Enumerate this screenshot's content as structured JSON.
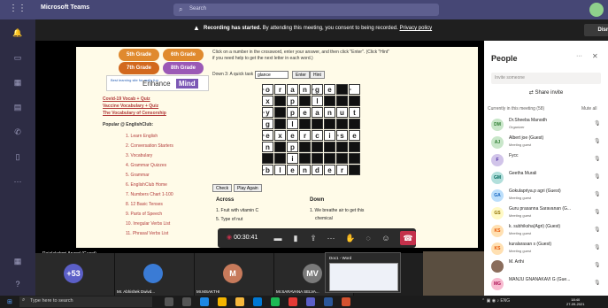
{
  "titlebar": {
    "app": "Microsoft Teams",
    "search_placeholder": "Search"
  },
  "banner": {
    "bold": "Recording has started.",
    "text": " By attending this meeting, you consent to being recorded. ",
    "link": "Privacy policy",
    "dismiss": "Dismiss"
  },
  "shared": {
    "grades": [
      "5th Grade",
      "6th Grade",
      "7th Grade",
      "8th Grade"
    ],
    "grade_colors": [
      "#e08a2e",
      "#e08a2e",
      "#d2691e",
      "#9b59b6"
    ],
    "mind": {
      "small": "Best learning site for really fun",
      "mid": "Enhance",
      "badge": "Mind"
    },
    "links_bold": [
      "Covid-19 Vocab + Quiz",
      "Vaccine Vocabulary + Quiz",
      "The Vocabulary of Censorship"
    ],
    "popular": "Popular @ EnglishClub:",
    "links": [
      "1. Learn English",
      "2. Conversation Starters",
      "3. Vocabulary",
      "4. Grammar Quizzes",
      "5. Grammar",
      "6. EnglishClub Home",
      "7. Numbers Chart 1-100",
      "8. 12 Basic Tenses",
      "9. Parts of Speech",
      "10. Irregular Verbs List",
      "11. Phrasal Verbs List"
    ],
    "instructions": "Click on a number in the crossword, enter your answer, and then click \"Enter\". (Click \"Hint\" if you need help to get the next letter in each word.)",
    "down_label": "Down 3: A quick task",
    "answer": "glance",
    "enter": "Enter",
    "hint": "Hint",
    "check": "Check",
    "play_again": "Play Again",
    "across_h": "Across",
    "down_h": "Down",
    "across_clues": [
      "1. Fruit with vitamin C",
      "5. Type of nut"
    ],
    "down_clues": [
      "1. We breathe air to get this",
      "chemical"
    ],
    "crossword": [
      [
        "",
        "1o",
        "r",
        "a",
        "n",
        "2g",
        "e",
        "",
        "3"
      ],
      [
        "",
        "x",
        "",
        "p",
        "",
        "l",
        "",
        "",
        ""
      ],
      [
        "",
        "4y",
        "",
        "p",
        "e",
        "a",
        "n",
        "u",
        "t"
      ],
      [
        "",
        "g",
        "",
        "l",
        "",
        "",
        "",
        "",
        ""
      ],
      [
        "",
        "5e",
        "x",
        "e",
        "r",
        "c",
        "i",
        "6s",
        "e"
      ],
      [
        "",
        "n",
        "",
        "p",
        "",
        "",
        "",
        "",
        ""
      ],
      [
        "",
        "",
        "",
        "i",
        "",
        "",
        "",
        "",
        ""
      ],
      [
        "",
        "7b",
        "l",
        "e",
        "n",
        "d",
        "e",
        "r",
        ""
      ]
    ]
  },
  "call": {
    "time": "00:30:41",
    "presenter": "Rajalakshmi Anand (Guest)",
    "word_tip": "Doc1 - Word"
  },
  "tiles": [
    {
      "label": "+53",
      "name": "",
      "color": "#5b5fc7"
    },
    {
      "label": "",
      "name": "Mr. Abhishek Dwivd...",
      "color": "#3a7bd5"
    },
    {
      "label": "M",
      "name": "Mr.MSAKTHI",
      "color": "#c77a5b"
    },
    {
      "label": "MV",
      "name": "Mr.SARAVANA SELVA...",
      "color": "#7a7a7a"
    }
  ],
  "people": {
    "title": "People",
    "invite_placeholder": "Invite someone",
    "share_invite": "Share invite",
    "currently": "Currently in this meeting (58)",
    "mute_all": "Mute all",
    "members": [
      {
        "initials": "DM",
        "name": "Dr.Sheeba Manodh",
        "role": "Organizer",
        "bg": "#c8e6c9",
        "fg": "#2e7d32"
      },
      {
        "initials": "AJ",
        "name": "Albert joe (Guest)",
        "role": "Meeting guest",
        "bg": "#c8e6c9",
        "fg": "#2e7d32"
      },
      {
        "initials": "F",
        "name": "Fycc",
        "role": "",
        "bg": "#d1c4e9",
        "fg": "#4527a0"
      },
      {
        "initials": "GM",
        "name": "Geetha Murali",
        "role": "",
        "bg": "#b2dfdb",
        "fg": "#00695c"
      },
      {
        "initials": "GA",
        "name": "Gokulapriya.p agri (Guest)",
        "role": "Meeting guest",
        "bg": "#bbdefb",
        "fg": "#1565c0"
      },
      {
        "initials": "GS",
        "name": "Guru prasanna Saravanan (G...",
        "role": "Meeting guest",
        "bg": "#fff9c4",
        "fg": "#8d6e00"
      },
      {
        "initials": "KS",
        "name": "k. subhiksha(Agri) (Guest)",
        "role": "Meeting guest",
        "bg": "#ffe0b2",
        "fg": "#e65100"
      },
      {
        "initials": "KS",
        "name": "kuralarasan s (Guest)",
        "role": "Meeting guest",
        "bg": "#ffe0b2",
        "fg": "#e65100"
      },
      {
        "initials": "",
        "name": "M. Arthi",
        "role": "",
        "bg": "#8a6d5c",
        "fg": "#fff"
      },
      {
        "initials": "MG",
        "name": "MANJU GNANAKAVI G (Gue...",
        "role": "",
        "bg": "#f8bbd0",
        "fg": "#ad1457"
      }
    ]
  },
  "taskbar": {
    "search": "Type here to search",
    "time": "18:40",
    "date": "27-09-2021",
    "lang": "ENG"
  }
}
